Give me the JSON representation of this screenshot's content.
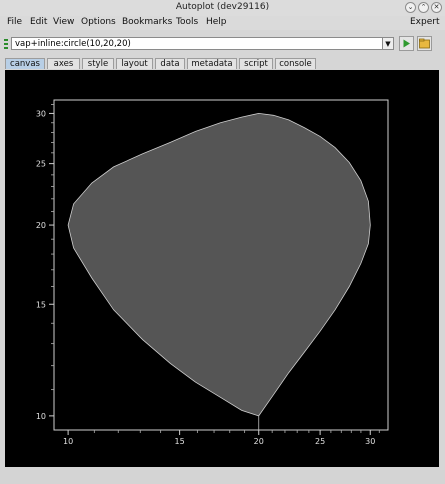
{
  "window": {
    "title": "Autoplot (dev29116)"
  },
  "menubar": {
    "items": [
      "File",
      "Edit",
      "View",
      "Options",
      "Bookmarks",
      "Tools",
      "Help"
    ],
    "right_label": "Expert"
  },
  "address": {
    "value": "vap+inline:circle(10,20,20)"
  },
  "tabs": [
    "canvas",
    "axes",
    "style",
    "layout",
    "data",
    "metadata",
    "script",
    "console"
  ],
  "selected_tab": "canvas",
  "chart_data": {
    "type": "area",
    "title": "",
    "xlabel": "",
    "ylabel": "",
    "x_scale": "log",
    "y_scale": "log",
    "xlim": [
      9.5,
      32
    ],
    "ylim": [
      9.5,
      31.5
    ],
    "x_ticks": [
      10,
      15,
      20,
      25,
      30
    ],
    "y_ticks": [
      10,
      15,
      20,
      25,
      30
    ],
    "x_tick_labels": [
      "10",
      "15",
      "20",
      "25",
      "30"
    ],
    "y_tick_labels": [
      "10",
      "15",
      "20",
      "25",
      "30"
    ],
    "background": "#000000",
    "fill": "#555555",
    "series": [
      {
        "x": [
          30.0,
          29.8,
          29.0,
          27.8,
          26.4,
          25.0,
          23.6,
          22.3,
          21.1,
          20.0,
          18.8,
          17.4,
          15.9,
          14.5,
          13.1,
          11.8,
          10.9,
          10.2,
          10.0,
          10.2,
          10.9,
          11.8,
          13.1,
          14.5,
          15.9,
          17.4,
          18.8,
          20.0,
          21.1,
          22.3,
          23.6,
          25.0,
          26.4,
          27.8,
          29.0,
          29.8,
          30.0
        ],
        "y": [
          20.0,
          18.7,
          17.4,
          16.0,
          14.7,
          13.6,
          12.6,
          11.7,
          10.8,
          10.0,
          10.2,
          10.7,
          11.3,
          12.1,
          13.2,
          14.7,
          16.5,
          18.4,
          20.0,
          21.6,
          23.3,
          24.7,
          25.9,
          27.0,
          28.1,
          29.0,
          29.6,
          30.0,
          29.8,
          29.3,
          28.5,
          27.6,
          26.5,
          25.1,
          23.5,
          21.8,
          20.0
        ]
      }
    ]
  }
}
